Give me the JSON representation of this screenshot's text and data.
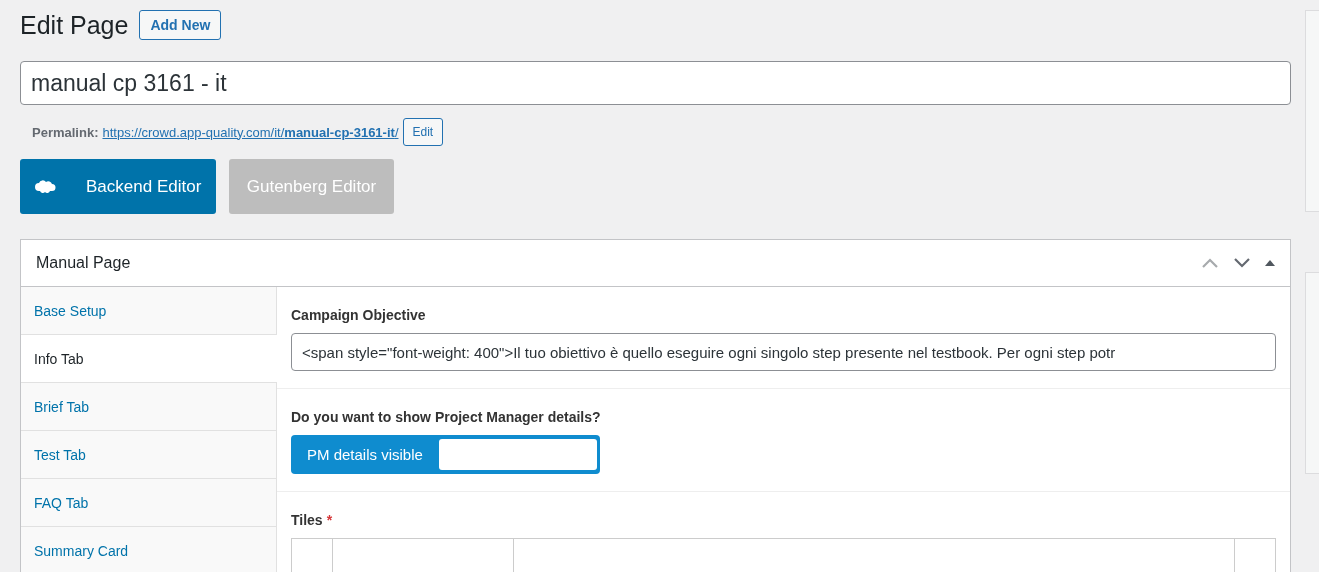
{
  "heading": {
    "title": "Edit Page",
    "add_new": "Add New"
  },
  "title_field": {
    "value": "manual cp 3161 - it"
  },
  "permalink": {
    "label": "Permalink:",
    "url_base": "https://crowd.app-quality.com/it/",
    "url_slug": "manual-cp-3161-it",
    "url_end": "/",
    "edit": "Edit"
  },
  "editor_buttons": [
    {
      "label": "Backend Editor",
      "selected": true
    },
    {
      "label": "Gutenberg Editor",
      "selected": false
    }
  ],
  "metabox": {
    "title": "Manual Page",
    "expanded": true,
    "tabs": [
      {
        "label": "Base Setup",
        "selected": false
      },
      {
        "label": "Info Tab",
        "selected": true
      },
      {
        "label": "Brief Tab",
        "selected": false
      },
      {
        "label": "Test Tab",
        "selected": false
      },
      {
        "label": "FAQ Tab",
        "selected": false
      },
      {
        "label": "Summary Card",
        "selected": false
      }
    ],
    "fields": [
      {
        "kind": "text",
        "label": "Campaign Objective",
        "value": "<span style=\"font-weight: 400\">Il tuo obiettivo è quello eseguire ogni singolo step presente nel testbook. Per ogni step potr"
      },
      {
        "kind": "toggle",
        "label": "Do you want to show Project Manager details?",
        "toggle_label": "PM details visible",
        "on": true
      },
      {
        "kind": "table",
        "label": "Tiles",
        "required_mark": "*"
      }
    ]
  }
}
